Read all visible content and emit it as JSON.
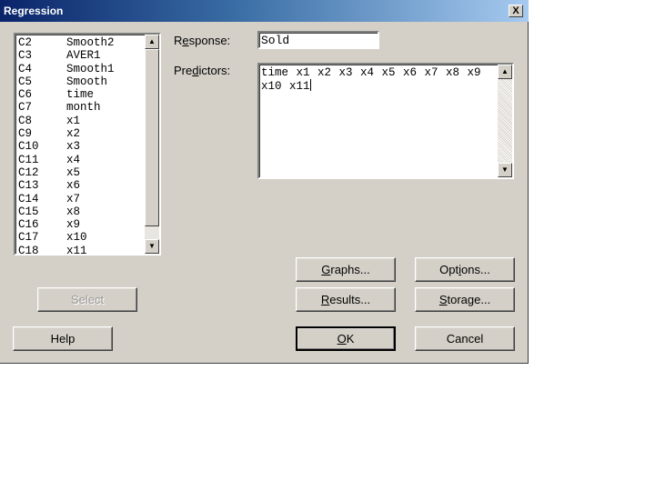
{
  "window": {
    "title": "Regression",
    "close_glyph": "X"
  },
  "variables": [
    {
      "col": "C2",
      "name": "Smooth2"
    },
    {
      "col": "C3",
      "name": "AVER1"
    },
    {
      "col": "C4",
      "name": "Smooth1"
    },
    {
      "col": "C5",
      "name": "Smooth"
    },
    {
      "col": "C6",
      "name": "time"
    },
    {
      "col": "C7",
      "name": "month"
    },
    {
      "col": "C8",
      "name": "x1"
    },
    {
      "col": "C9",
      "name": "x2"
    },
    {
      "col": "C10",
      "name": "x3"
    },
    {
      "col": "C11",
      "name": "x4"
    },
    {
      "col": "C12",
      "name": "x5"
    },
    {
      "col": "C13",
      "name": "x6"
    },
    {
      "col": "C14",
      "name": "x7"
    },
    {
      "col": "C15",
      "name": "x8"
    },
    {
      "col": "C16",
      "name": "x9"
    },
    {
      "col": "C17",
      "name": "x10"
    },
    {
      "col": "C18",
      "name": "x11"
    }
  ],
  "response": {
    "label_pre": "R",
    "label_key": "e",
    "label_post": "sponse:",
    "value": "Sold"
  },
  "predictors": {
    "label_pre": "Pre",
    "label_key": "d",
    "label_post": "ictors:",
    "value": "time x1 x2 x3 x4 x5 x6 x7 x8 x9 x10 x11"
  },
  "buttons": {
    "select": "Select",
    "help": "Help",
    "graphs": {
      "key": "G",
      "rest": "raphs..."
    },
    "options": {
      "pre": "Opt",
      "key": "i",
      "rest": "ons..."
    },
    "results": {
      "key": "R",
      "rest": "esults..."
    },
    "storage": {
      "pre": "",
      "key": "S",
      "rest": "torage..."
    },
    "ok": {
      "key": "O",
      "rest": "K"
    },
    "cancel": "Cancel"
  },
  "icons": {
    "scroll_up": "up-arrow",
    "scroll_down": "down-arrow"
  }
}
